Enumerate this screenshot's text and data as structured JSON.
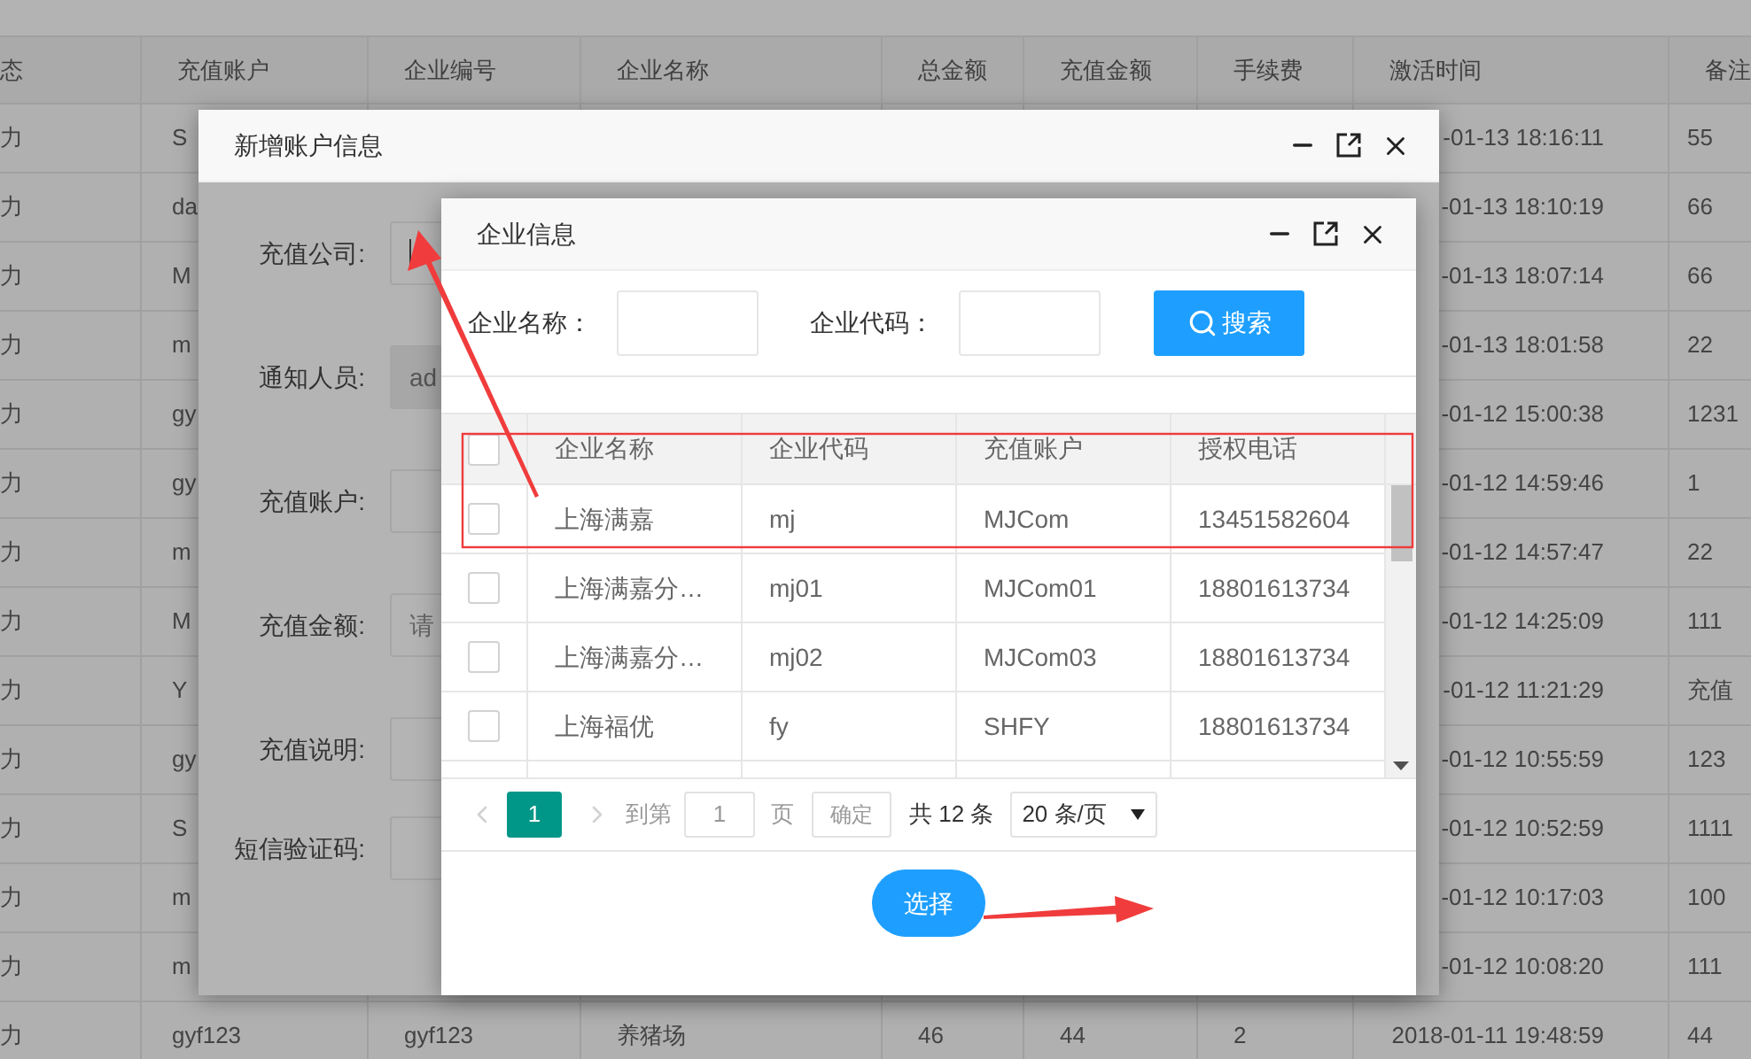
{
  "background_table": {
    "columns": [
      "态",
      "充值账户",
      "企业编号",
      "企业名称",
      "总金额",
      "充值金额",
      "手续费",
      "激活时间",
      "备注"
    ],
    "rows": [
      [
        "力",
        "S",
        null,
        null,
        null,
        null,
        null,
        "-01-13 18:16:11",
        "55"
      ],
      [
        "力",
        "da",
        null,
        null,
        null,
        null,
        null,
        "-01-13 18:10:19",
        "66"
      ],
      [
        "力",
        "M",
        null,
        null,
        null,
        null,
        null,
        "-01-13 18:07:14",
        "66"
      ],
      [
        "力",
        "m",
        null,
        null,
        null,
        null,
        null,
        "-01-13 18:01:58",
        "22"
      ],
      [
        "力",
        "gy",
        null,
        null,
        null,
        null,
        null,
        "-01-12 15:00:38",
        "1231"
      ],
      [
        "力",
        "gy",
        null,
        null,
        null,
        null,
        null,
        "-01-12 14:59:46",
        "1"
      ],
      [
        "力",
        "m",
        null,
        null,
        null,
        null,
        null,
        "-01-12 14:57:47",
        "22"
      ],
      [
        "力",
        "M",
        null,
        null,
        null,
        null,
        null,
        "-01-12 14:25:09",
        "111"
      ],
      [
        "力",
        "Y",
        null,
        null,
        null,
        null,
        null,
        "-01-12 11:21:29",
        "充值"
      ],
      [
        "力",
        "gy",
        null,
        null,
        null,
        null,
        null,
        "-01-12 10:55:59",
        "123"
      ],
      [
        "力",
        "S",
        null,
        null,
        null,
        null,
        null,
        "-01-12 10:52:59",
        "1111"
      ],
      [
        "力",
        "m",
        null,
        null,
        null,
        null,
        null,
        "-01-12 10:17:03",
        "100"
      ],
      [
        "力",
        "m",
        null,
        null,
        null,
        null,
        null,
        "-01-12 10:08:20",
        "111"
      ],
      [
        "力",
        "gyf123",
        "gyf123",
        "养猪场",
        "46",
        "44",
        "2",
        "2018-01-11 19:48:59",
        "44"
      ]
    ]
  },
  "account_dialog": {
    "title": "新增账户信息",
    "fields": [
      {
        "label": "充值公司:",
        "kind": "caret",
        "disabled": false
      },
      {
        "label": "通知人员:",
        "kind": "text",
        "value": "ad",
        "disabled": true
      },
      {
        "label": "充值账户:",
        "kind": "text",
        "disabled": false
      },
      {
        "label": "充值金额:",
        "kind": "text",
        "placeholder": "请",
        "disabled": false
      },
      {
        "label": "充值说明:",
        "kind": "text",
        "disabled": false
      },
      {
        "label": "短信验证码:",
        "kind": "text",
        "disabled": false
      }
    ]
  },
  "company_dialog": {
    "title": "企业信息",
    "search_fields": [
      {
        "label": "企业名称："
      },
      {
        "label": "企业代码："
      }
    ],
    "search_button": "搜索",
    "table": {
      "columns": [
        "企业名称",
        "企业代码",
        "充值账户",
        "授权电话"
      ],
      "header_checked": false,
      "rows": [
        {
          "cells": [
            "上海满嘉",
            "mj",
            "MJCom",
            "13451582604"
          ],
          "checked": false
        },
        {
          "cells": [
            "上海满嘉分…",
            "mj01",
            "MJCom01",
            "18801613734"
          ],
          "checked": false
        },
        {
          "cells": [
            "上海满嘉分…",
            "mj02",
            "MJCom03",
            "18801613734"
          ],
          "checked": false
        },
        {
          "cells": [
            "上海福优",
            "fy",
            "SHFY",
            "18801613734"
          ],
          "checked": false
        }
      ]
    },
    "pagination": {
      "pages": [
        {
          "label": "1",
          "selected": true
        }
      ],
      "goto_label": "到第",
      "goto_value": "1",
      "page_unit": "页",
      "confirm": "确定",
      "total": "共 12 条",
      "page_size": "20 条/页"
    },
    "select_button": "选择"
  }
}
